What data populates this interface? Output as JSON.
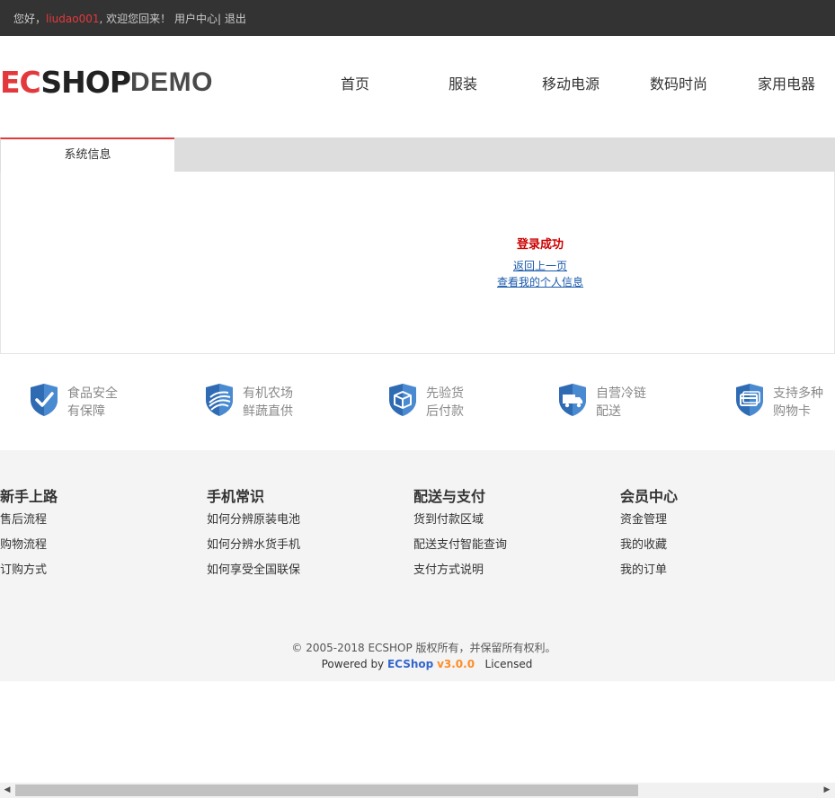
{
  "topbar": {
    "greeting": "您好，",
    "username": "liudao001",
    "welcome": ", 欢迎您回来！",
    "user_center": "用户中心",
    "separator": "|",
    "logout": "退出"
  },
  "logo": {
    "ec": "EC",
    "shop": "SHOP",
    "demo": "DEMO"
  },
  "nav": [
    "首页",
    "服装",
    "移动电源",
    "数码时尚",
    "家用电器"
  ],
  "panel": {
    "tab_label": "系统信息",
    "message": "登录成功",
    "links": [
      "返回上一页",
      "查看我的个人信息"
    ]
  },
  "services": [
    {
      "icon": "check-shield-icon",
      "line1": "食品安全",
      "line2": "有保障"
    },
    {
      "icon": "farm-shield-icon",
      "line1": "有机农场",
      "line2": "鲜蔬直供"
    },
    {
      "icon": "box-shield-icon",
      "line1": "先验货",
      "line2": "后付款"
    },
    {
      "icon": "truck-shield-icon",
      "line1": "自营冷链",
      "line2": "配送"
    },
    {
      "icon": "card-shield-icon",
      "line1": "支持多种",
      "line2": "购物卡"
    }
  ],
  "footer": {
    "columns": [
      {
        "title": "新手上路",
        "links": [
          "售后流程",
          "购物流程",
          "订购方式"
        ]
      },
      {
        "title": "手机常识",
        "links": [
          "如何分辨原装电池",
          "如何分辨水货手机",
          "如何享受全国联保"
        ]
      },
      {
        "title": "配送与支付",
        "links": [
          "货到付款区域",
          "配送支付智能查询",
          "支付方式说明"
        ]
      },
      {
        "title": "会员中心",
        "links": [
          "资金管理",
          "我的收藏",
          "我的订单"
        ]
      }
    ],
    "copyright": "© 2005-2018 ECSHOP 版权所有，并保留所有权利。",
    "powered_prefix": "Powered by ",
    "powered_brand": "ECShop",
    "powered_version": "v3.0.0",
    "powered_suffix": "Licensed"
  },
  "colors": {
    "accent": "#e4393c",
    "topbar_bg": "#333333",
    "shield": "#2f6bb3",
    "link": "#1a5aab"
  }
}
